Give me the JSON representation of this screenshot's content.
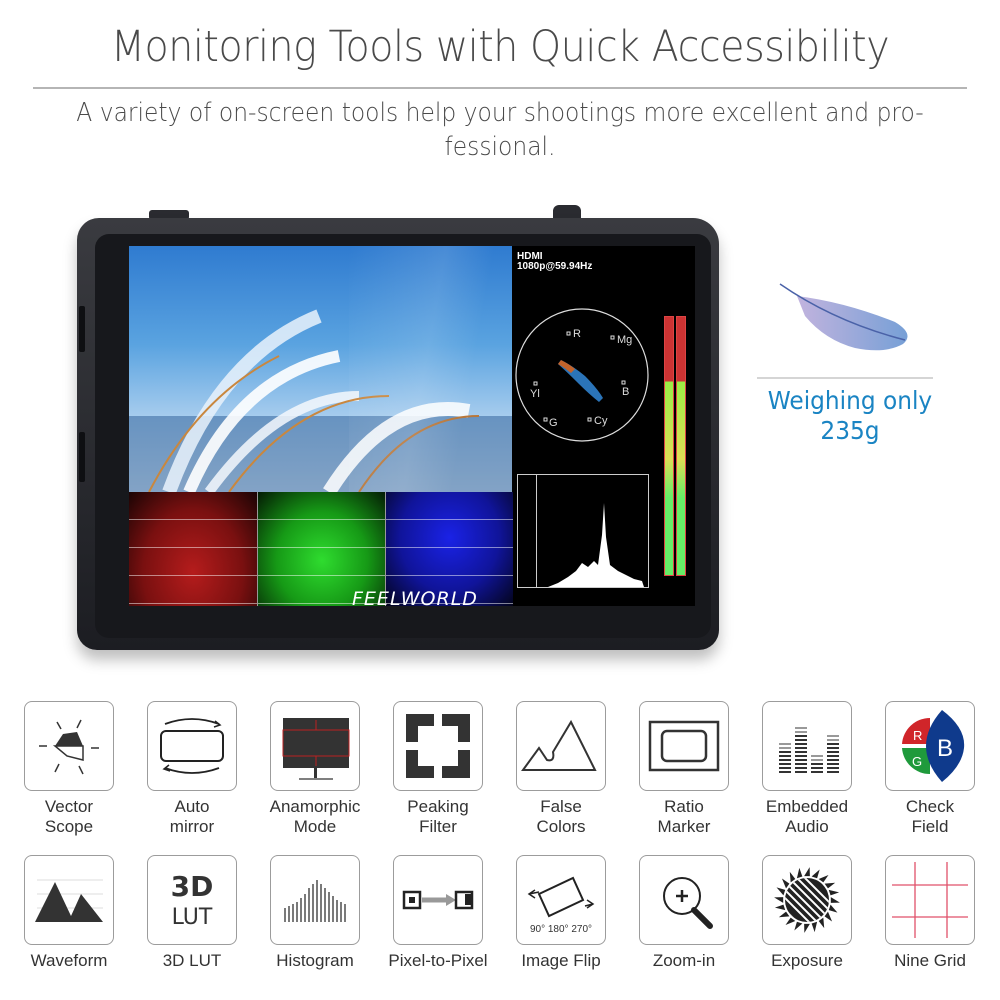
{
  "header": {
    "title": "Monitoring Tools with Quick Accessibility",
    "subtitle_line1": "A variety of on-screen tools help your shootings more excellent and pro-",
    "subtitle_line2": "fessional."
  },
  "monitor": {
    "brand": "FEELWORLD",
    "signal_source": "HDMI",
    "signal_format": "1080p@59.94Hz",
    "vectorscope_labels": [
      "R",
      "Mg",
      "Yl",
      "B",
      "G",
      "Cy"
    ],
    "waveform_channels": [
      {
        "name": "red",
        "color": "#c81e1e"
      },
      {
        "name": "green",
        "color": "#22c522"
      },
      {
        "name": "blue",
        "color": "#1a1ee0"
      }
    ]
  },
  "weight": {
    "line1": "Weighing only",
    "line2": "235g",
    "color": "#1a84c3"
  },
  "features": [
    {
      "icon": "vector-scope-icon",
      "line1": "Vector",
      "line2": "Scope"
    },
    {
      "icon": "auto-mirror-icon",
      "line1": "Auto",
      "line2": "mirror"
    },
    {
      "icon": "anamorphic-mode-icon",
      "line1": "Anamorphic",
      "line2": "Mode"
    },
    {
      "icon": "peaking-filter-icon",
      "line1": "Peaking",
      "line2": "Filter"
    },
    {
      "icon": "false-colors-icon",
      "line1": "False",
      "line2": "Colors"
    },
    {
      "icon": "ratio-marker-icon",
      "line1": "Ratio",
      "line2": "Marker"
    },
    {
      "icon": "embedded-audio-icon",
      "line1": "Embedded",
      "line2": "Audio"
    },
    {
      "icon": "check-field-icon",
      "line1": "Check",
      "line2": "Field"
    },
    {
      "icon": "waveform-icon",
      "line1": "Waveform",
      "line2": ""
    },
    {
      "icon": "3d-lut-icon",
      "line1": "3D LUT",
      "line2": ""
    },
    {
      "icon": "histogram-icon",
      "line1": "Histogram",
      "line2": ""
    },
    {
      "icon": "pixel-to-pixel-icon",
      "line1": "Pixel-to-Pixel",
      "line2": ""
    },
    {
      "icon": "image-flip-icon",
      "line1": "Image Flip",
      "line2": ""
    },
    {
      "icon": "zoom-in-icon",
      "line1": "Zoom-in",
      "line2": ""
    },
    {
      "icon": "exposure-icon",
      "line1": "Exposure",
      "line2": ""
    },
    {
      "icon": "nine-grid-icon",
      "line1": "Nine Grid",
      "line2": ""
    }
  ],
  "icon_text": {
    "lut_big": "3D",
    "lut_small": "LUT",
    "flip_degrees": "90° 180° 270°",
    "check_r": "R",
    "check_g": "G",
    "check_b": "B"
  }
}
